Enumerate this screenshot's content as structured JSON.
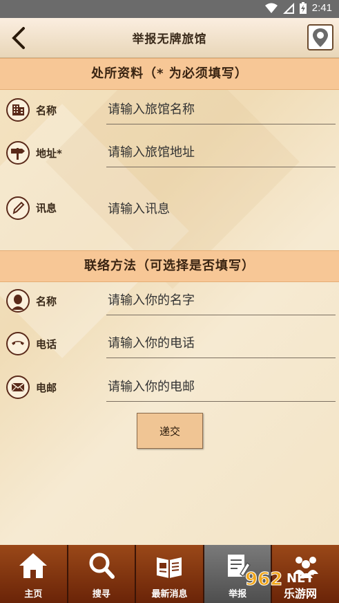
{
  "status": {
    "time": "2:41"
  },
  "header": {
    "title": "举报无牌旅馆"
  },
  "sections": [
    {
      "title": "处所资料（* 为必须填写）"
    },
    {
      "title": "联络方法（可选择是否填写）"
    }
  ],
  "premises": {
    "name_label": "名称",
    "name_placeholder": "请输入旅馆名称",
    "address_label": "地址*",
    "address_placeholder": "请输入旅馆地址",
    "info_label": "讯息",
    "info_placeholder": "请输入讯息"
  },
  "contact": {
    "name_label": "名称",
    "name_placeholder": "请输入你的名字",
    "phone_label": "电话",
    "phone_placeholder": "请输入你的电话",
    "email_label": "电邮",
    "email_placeholder": "请输入你的电邮"
  },
  "submit_label": "递交",
  "tabs": [
    {
      "label": "主页",
      "icon": "home-icon"
    },
    {
      "label": "搜寻",
      "icon": "search-icon"
    },
    {
      "label": "最新消息",
      "icon": "news-icon"
    },
    {
      "label": "举报",
      "icon": "report-icon"
    },
    {
      "label": "",
      "icon": "group-icon"
    }
  ],
  "watermark": {
    "text_top": "962",
    "text_net": "NET",
    "text_bottom": "乐游网"
  },
  "colors": {
    "section_header": "#f7c796",
    "tab_bar": "#7a2e0e",
    "accent_dark": "#5a2a1a"
  }
}
